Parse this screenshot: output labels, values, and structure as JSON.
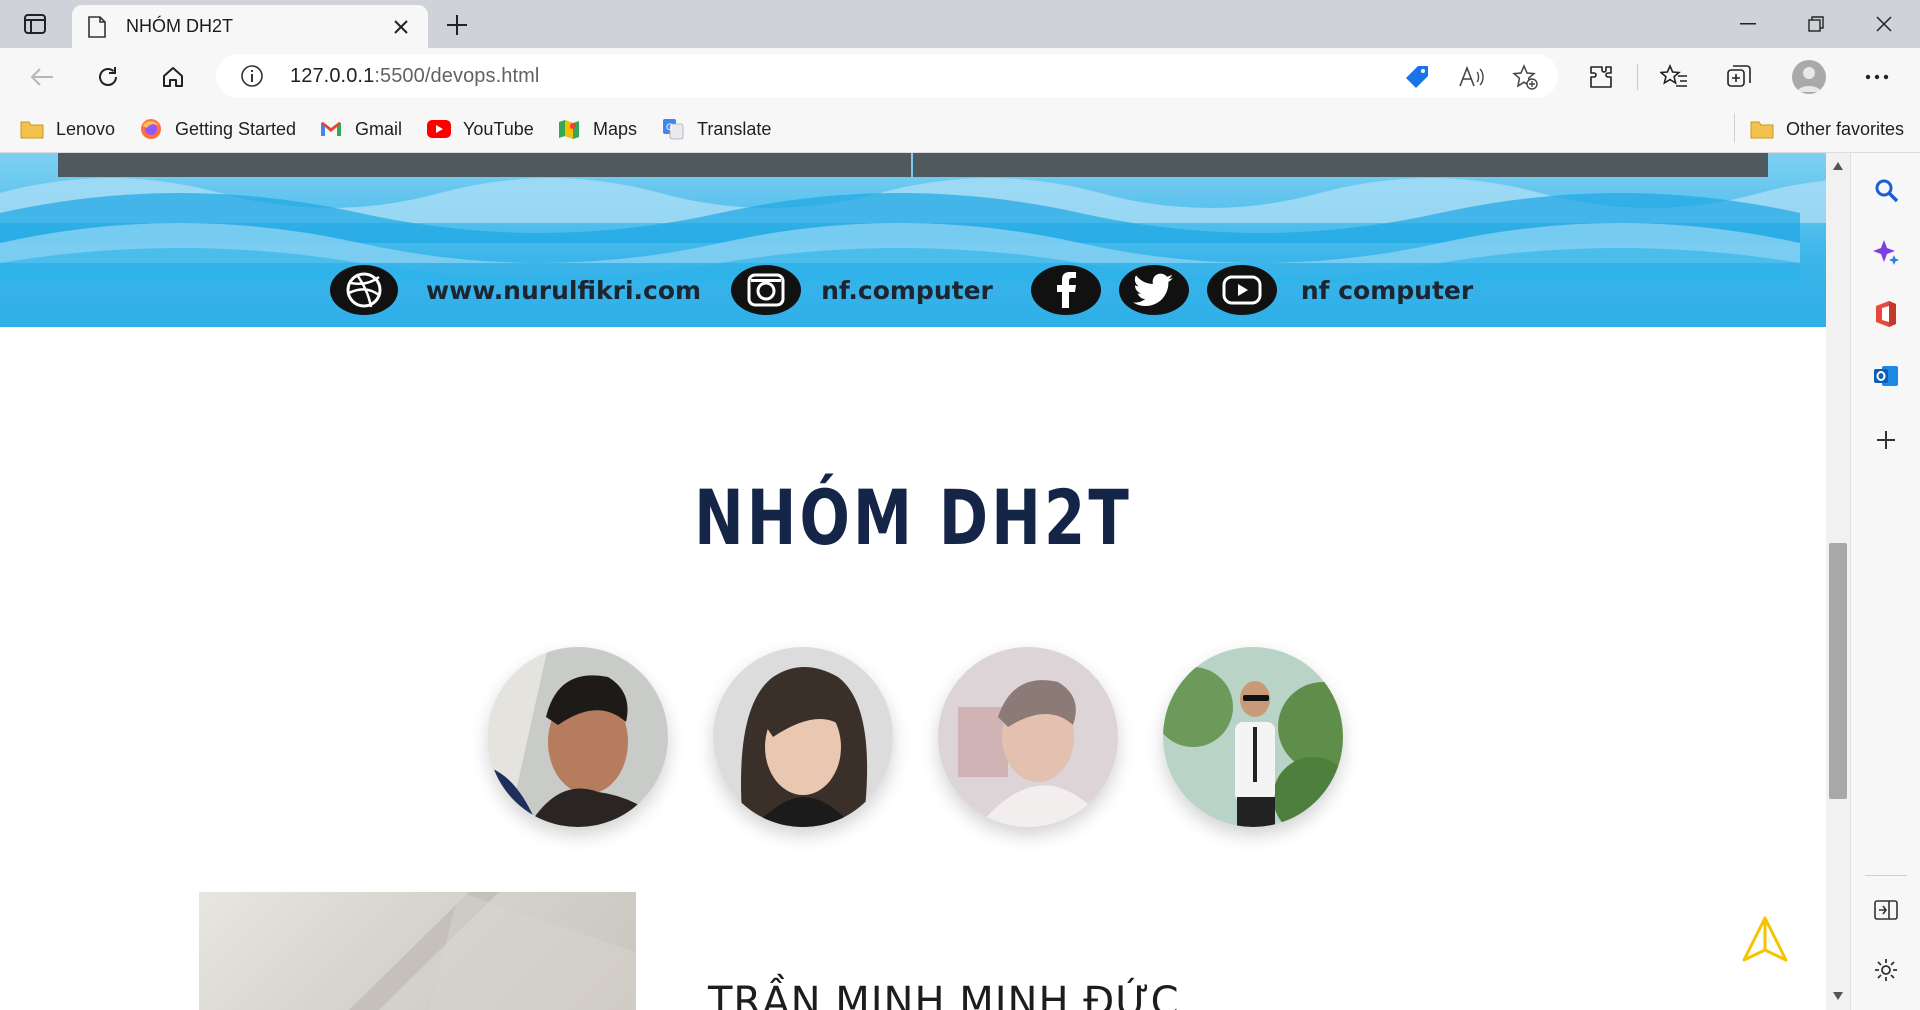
{
  "browser": {
    "tab_title": "NHÓM DH2T",
    "url_host": "127.0.0.1",
    "url_path": ":5500/devops.html",
    "favorites": [
      {
        "label": "Lenovo",
        "icon": "folder-icon"
      },
      {
        "label": "Getting Started",
        "icon": "firefox-icon"
      },
      {
        "label": "Gmail",
        "icon": "gmail-icon"
      },
      {
        "label": "YouTube",
        "icon": "youtube-icon"
      },
      {
        "label": "Maps",
        "icon": "maps-icon"
      },
      {
        "label": "Translate",
        "icon": "translate-icon"
      }
    ],
    "other_favorites": "Other favorites"
  },
  "banner": {
    "website": "www.nurulfikri.com",
    "instagram": "nf.computer",
    "social_name": "nf computer"
  },
  "team": {
    "title": "NHÓM DH2T",
    "members": [
      {
        "photo": "member-1-photo"
      },
      {
        "photo": "member-2-photo"
      },
      {
        "photo": "member-3-photo"
      },
      {
        "photo": "member-4-photo"
      }
    ]
  },
  "profile": {
    "name": "TRẦN MINH MINH ĐỨC"
  },
  "colors": {
    "title": "#152548",
    "banner_blue": "#3cb6ea",
    "scroll_top_accent": "#f5c400"
  }
}
